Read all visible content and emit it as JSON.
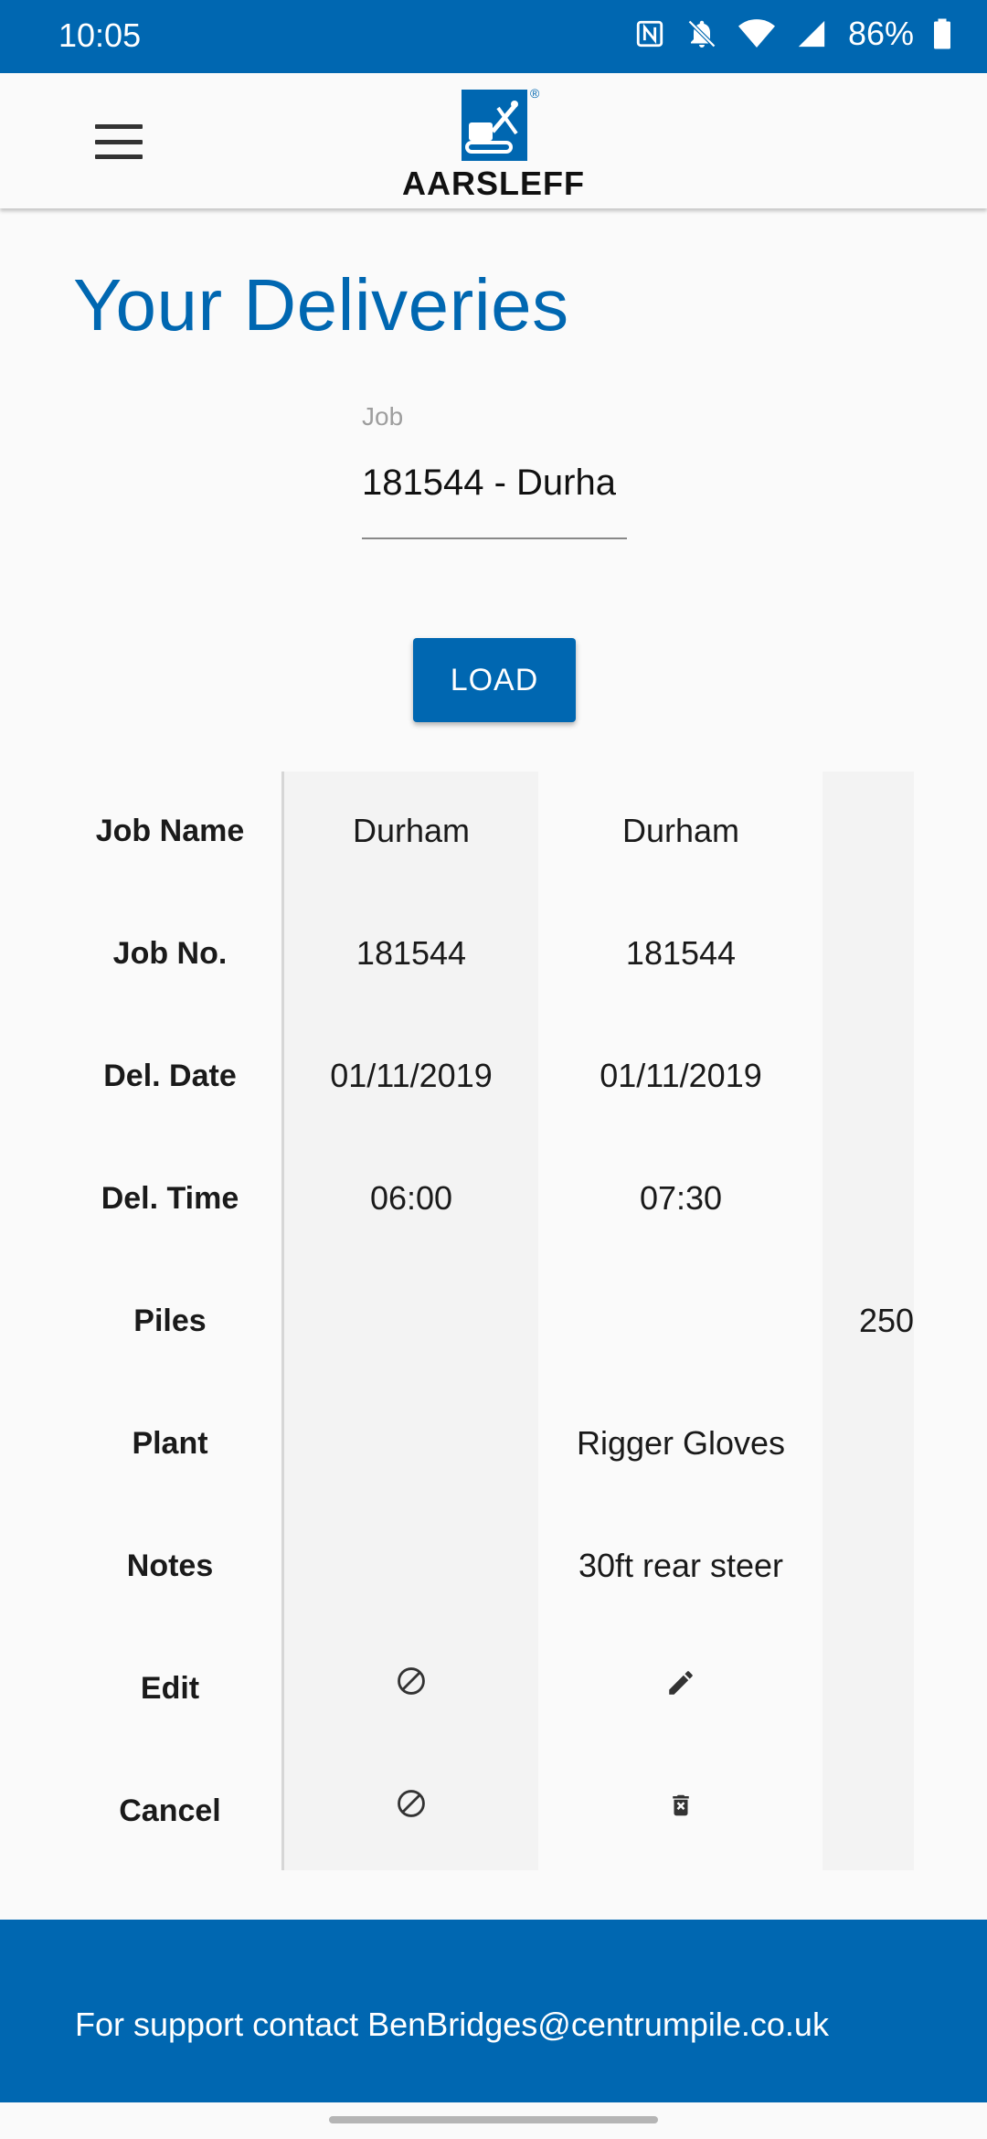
{
  "status_bar": {
    "time": "10:05",
    "battery": "86%",
    "icons": [
      "nfc-icon",
      "bell-off-icon",
      "wifi-icon",
      "signal-icon",
      "battery-icon"
    ]
  },
  "app_bar": {
    "logo_text": "AARSLEFF",
    "brand_color": "#0067b1"
  },
  "page": {
    "title": "Your Deliveries"
  },
  "job_field": {
    "label": "Job",
    "value": "181544 - Durha"
  },
  "load_button": {
    "label": "LOAD"
  },
  "table": {
    "row_labels": [
      "Job Name",
      "Job No.",
      "Del. Date",
      "Del. Time",
      "Piles",
      "Plant",
      "Notes",
      "Edit",
      "Cancel"
    ],
    "columns": [
      {
        "job_name": "Durham",
        "job_no": "181544",
        "del_date": "01/11/2019",
        "del_time": "06:00",
        "piles": "",
        "plant": "",
        "notes": "",
        "edit_icon": "block-icon",
        "cancel_icon": "block-icon"
      },
      {
        "job_name": "Durham",
        "job_no": "181544",
        "del_date": "01/11/2019",
        "del_time": "07:30",
        "piles": "",
        "plant": "Rigger Gloves",
        "notes": "30ft rear steer",
        "edit_icon": "pencil-icon",
        "cancel_icon": "delete-icon"
      },
      {
        "job_name": "",
        "job_no": "",
        "del_date": "",
        "del_time": "",
        "piles": "250",
        "plant": "",
        "notes": "",
        "edit_icon": "",
        "cancel_icon": ""
      }
    ]
  },
  "footer": {
    "text": "For support contact BenBridges@centrumpile.co.uk"
  }
}
